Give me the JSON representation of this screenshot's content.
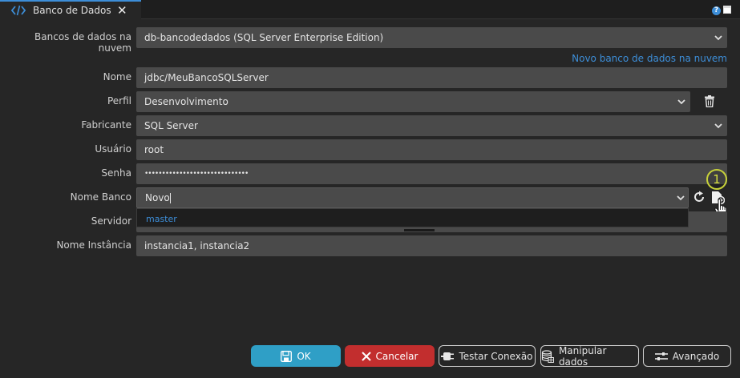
{
  "tab": {
    "title": "Banco de Dados",
    "close": "✕"
  },
  "window": {
    "help": "?"
  },
  "fields": {
    "cloud_label": "Bancos de dados na nuvem",
    "cloud_value": "db-bancodedados (SQL Server Enterprise Edition)",
    "new_cloud_link": "Novo banco de dados na nuvem",
    "nome_label": "Nome",
    "nome_value": "jdbc/MeuBancoSQLServer",
    "perfil_label": "Perfil",
    "perfil_value": "Desenvolvimento",
    "fabricante_label": "Fabricante",
    "fabricante_value": "SQL Server",
    "usuario_label": "Usuário",
    "usuario_value": "root",
    "senha_label": "Senha",
    "senha_value": "••••••••••••••••••••••••••••••",
    "nome_banco_label": "Nome Banco",
    "nome_banco_value": "Novo",
    "servidor_label": "Servidor",
    "nome_instancia_label": "Nome Instância",
    "nome_instancia_value": "instancia1, instancia2"
  },
  "dropdown": {
    "options": [
      "master"
    ]
  },
  "badge": "1",
  "buttons": {
    "ok": "OK",
    "cancel": "Cancelar",
    "test": "Testar Conexão",
    "manipulate": "Manipular dados",
    "advanced": "Avançado"
  },
  "colors": {
    "accent": "#3d8ed8",
    "ok": "#2f9fc6",
    "cancel": "#c22e2e",
    "badge": "#c7d13a"
  }
}
